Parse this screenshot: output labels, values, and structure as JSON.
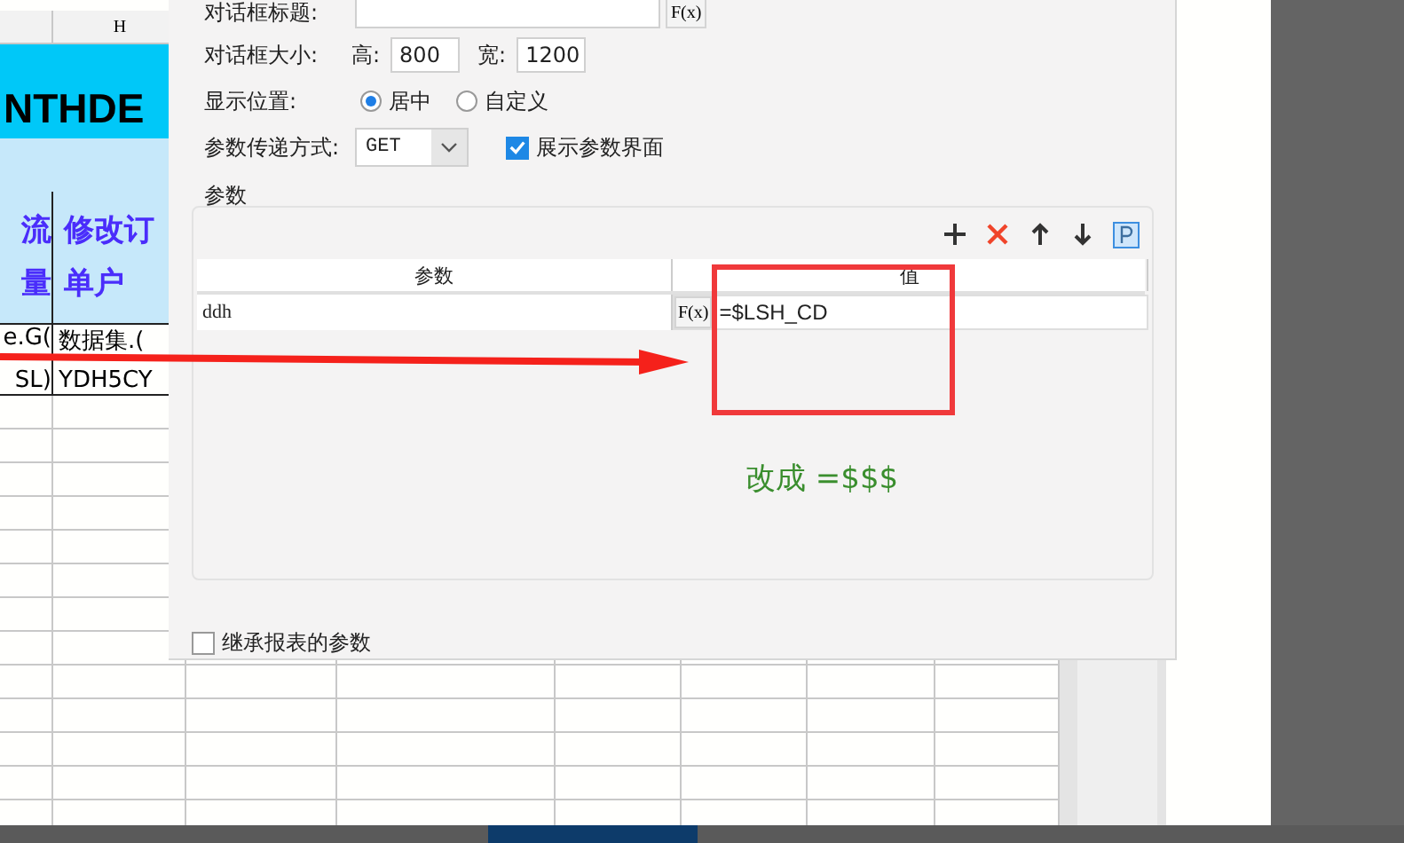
{
  "spreadsheet": {
    "column_header": "H",
    "banner": "NTHDE",
    "header_cells": [
      [
        "流",
        "量"
      ],
      [
        "修改订",
        "单户"
      ]
    ],
    "data_rows": [
      [
        "e.G(",
        "数据集.("
      ],
      [
        "SL)",
        "YDH5CY"
      ]
    ]
  },
  "dialog": {
    "title_label": "对话框标题:",
    "title_formula_button": "F(x)",
    "size_label": "对话框大小:",
    "height_label": "高:",
    "height_value": "800",
    "width_label": "宽:",
    "width_value": "1200",
    "position_label": "显示位置:",
    "position_options": [
      {
        "label": "居中",
        "selected": true
      },
      {
        "label": "自定义",
        "selected": false
      }
    ],
    "method_label": "参数传递方式:",
    "method_value": "GET",
    "show_params": {
      "label": "展示参数界面",
      "checked": true
    },
    "params_group": {
      "title": "参数",
      "columns": [
        "参数",
        "值"
      ],
      "rows": [
        {
          "name": "ddh",
          "formula_button": "F(x)",
          "value": "=$LSH_CD"
        }
      ]
    },
    "inherit_params": {
      "label": "继承报表的参数",
      "checked": false
    }
  },
  "annotations": [
    {
      "kind": "arrow"
    },
    {
      "kind": "box"
    },
    {
      "kind": "note",
      "text": "改成 =$$$"
    }
  ]
}
